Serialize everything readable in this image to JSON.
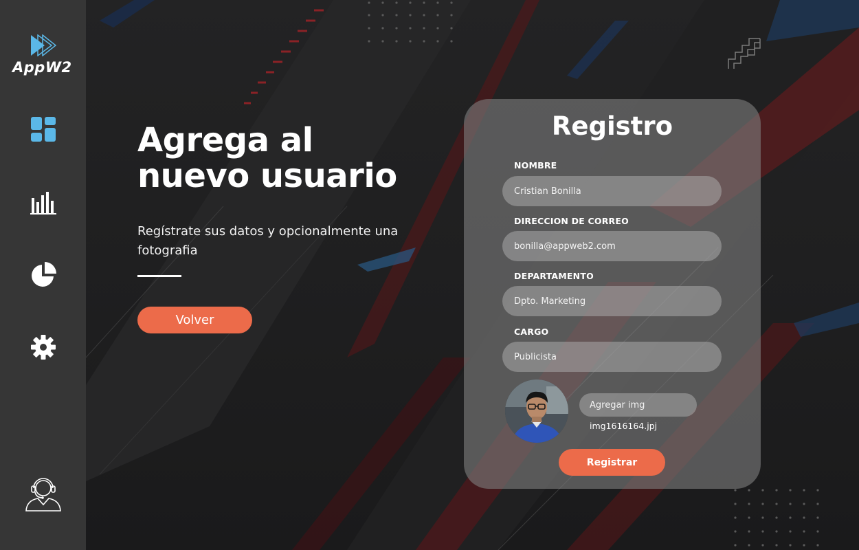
{
  "app": {
    "name": "AppW2"
  },
  "colors": {
    "accent": "#ec6b4a",
    "sidebar": "#363636",
    "icon_blue": "#5bb8e8",
    "background": "#1b1b1c"
  },
  "sidebar": {
    "items": [
      {
        "icon": "dashboard-icon"
      },
      {
        "icon": "bar-chart-icon"
      },
      {
        "icon": "pie-chart-icon"
      },
      {
        "icon": "gear-icon"
      },
      {
        "icon": "support-agent-icon"
      }
    ]
  },
  "hero": {
    "title_line1": "Agrega al",
    "title_line2": "nuevo usuario",
    "subtitle": "Regístrate sus datos y opcionalmente una fotografia",
    "back_button": "Volver"
  },
  "form": {
    "title": "Registro",
    "fields": [
      {
        "label": "NOMBRE",
        "value": "Cristian Bonilla"
      },
      {
        "label": "DIRECCION DE CORREO",
        "value": "bonilla@appweb2.com"
      },
      {
        "label": "DEPARTAMENTO",
        "value": "Dpto. Marketing"
      },
      {
        "label": "CARGO",
        "value": "Publicista"
      }
    ],
    "add_image_button": "Agregar img",
    "file_name": "img1616164.jpj",
    "submit_button": "Registrar"
  }
}
